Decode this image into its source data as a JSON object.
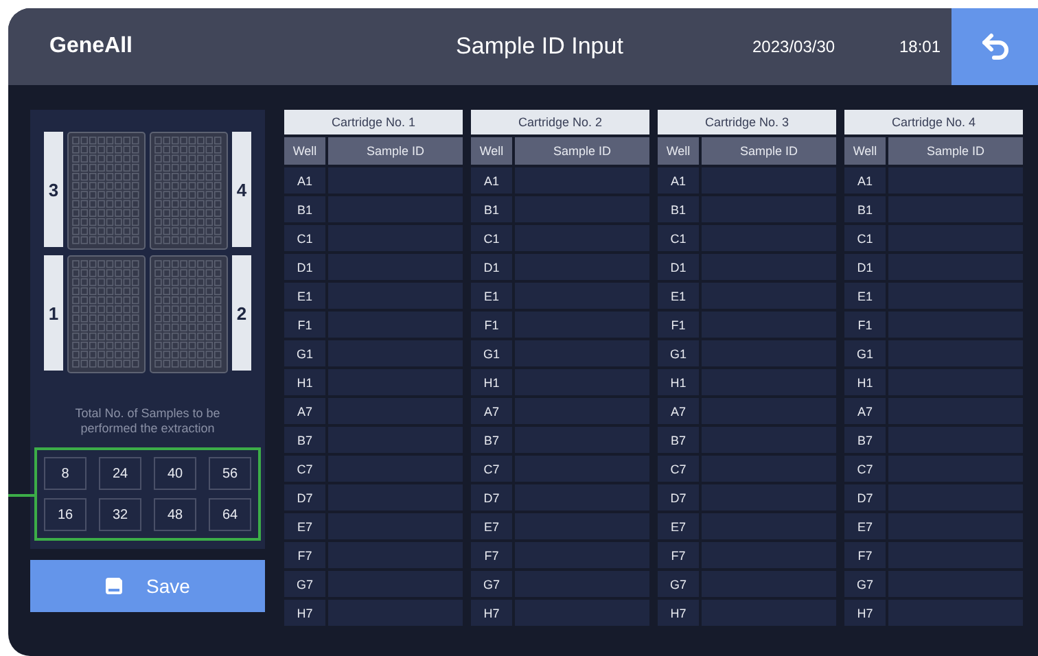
{
  "header": {
    "brand": "GeneAll",
    "title": "Sample ID Input",
    "date": "2023/03/30",
    "time": "18:01"
  },
  "plates": [
    {
      "label": "3"
    },
    {
      "label": "4"
    },
    {
      "label": "1"
    },
    {
      "label": "2"
    }
  ],
  "sample_counts": {
    "caption": "Total No. of Samples to be performed the extraction",
    "highlighted": true,
    "options": [
      {
        "label": "8",
        "selected": false
      },
      {
        "label": "24",
        "selected": false
      },
      {
        "label": "40",
        "selected": false
      },
      {
        "label": "56",
        "selected": false
      },
      {
        "label": "16",
        "selected": false
      },
      {
        "label": "32",
        "selected": false
      },
      {
        "label": "48",
        "selected": false
      },
      {
        "label": "64",
        "selected": false
      }
    ]
  },
  "save_button": {
    "label": "Save"
  },
  "cartridges": [
    {
      "title": "Cartridge No. 1",
      "columns": [
        "Well",
        "Sample ID"
      ],
      "wells": [
        "A1",
        "B1",
        "C1",
        "D1",
        "E1",
        "F1",
        "G1",
        "H1",
        "A7",
        "B7",
        "C7",
        "D7",
        "E7",
        "F7",
        "G7",
        "H7"
      ]
    },
    {
      "title": "Cartridge No. 2",
      "columns": [
        "Well",
        "Sample ID"
      ],
      "wells": [
        "A1",
        "B1",
        "C1",
        "D1",
        "E1",
        "F1",
        "G1",
        "H1",
        "A7",
        "B7",
        "C7",
        "D7",
        "E7",
        "F7",
        "G7",
        "H7"
      ]
    },
    {
      "title": "Cartridge No. 3",
      "columns": [
        "Well",
        "Sample ID"
      ],
      "wells": [
        "A1",
        "B1",
        "C1",
        "D1",
        "E1",
        "F1",
        "G1",
        "H1",
        "A7",
        "B7",
        "C7",
        "D7",
        "E7",
        "F7",
        "G7",
        "H7"
      ]
    },
    {
      "title": "Cartridge No. 4",
      "columns": [
        "Well",
        "Sample ID"
      ],
      "wells": [
        "A1",
        "B1",
        "C1",
        "D1",
        "E1",
        "F1",
        "G1",
        "H1",
        "A7",
        "B7",
        "C7",
        "D7",
        "E7",
        "F7",
        "G7",
        "H7"
      ]
    }
  ]
}
